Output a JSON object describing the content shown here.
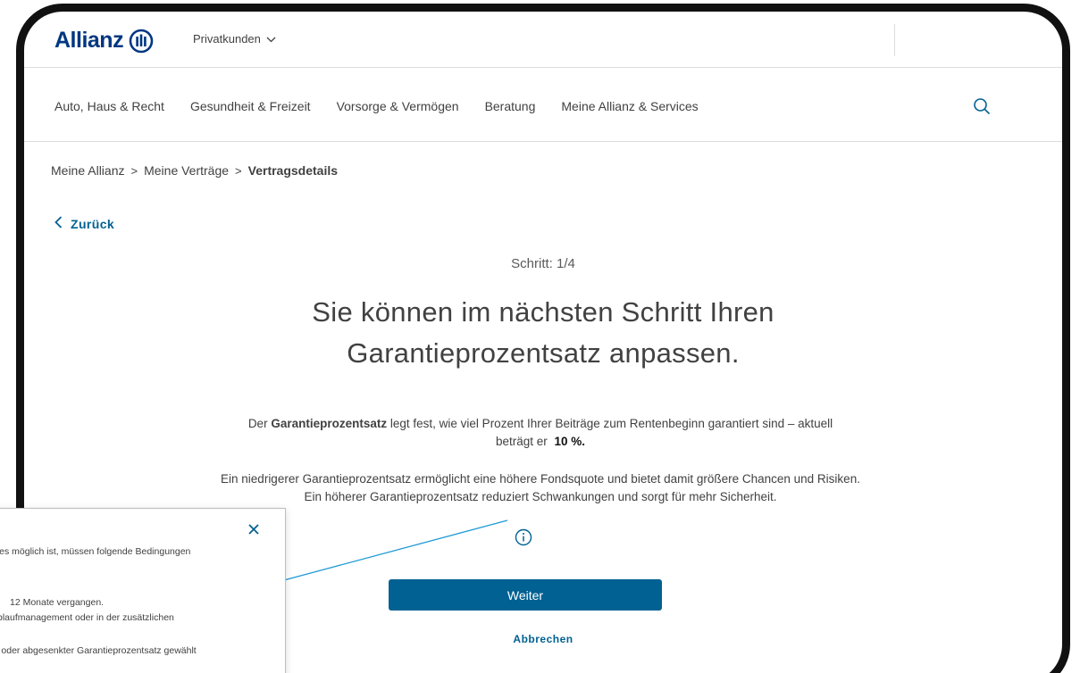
{
  "brand": {
    "name": "Allianz"
  },
  "topbar": {
    "segment_label": "Privatkunden"
  },
  "nav": {
    "items": [
      {
        "label": "Auto, Haus & Recht"
      },
      {
        "label": "Gesundheit & Freizeit"
      },
      {
        "label": "Vorsorge & Vermögen"
      },
      {
        "label": "Beratung"
      },
      {
        "label": "Meine Allianz & Services"
      }
    ]
  },
  "breadcrumb": {
    "items": [
      {
        "label": "Meine Allianz"
      },
      {
        "label": "Meine Verträge"
      },
      {
        "label": "Vertragsdetails"
      }
    ],
    "separator": ">"
  },
  "back": {
    "label": "Zurück"
  },
  "main": {
    "step": "Schritt: 1/4",
    "headline_line1": "Sie können im nächsten Schritt Ihren",
    "headline_line2": "Garantieprozentsatz anpassen.",
    "para1_prefix": "Der",
    "para1_bold": "Garantieprozentsatz",
    "para1_rest": "legt fest, wie viel Prozent Ihrer Beiträge zum Rentenbeginn garantiert sind – aktuell beträgt er",
    "para1_value": "10 %.",
    "para2": "Ein niedrigerer Garantieprozentsatz ermöglicht eine höhere Fondsquote und bietet damit größere Chancen und Risiken. Ein höherer Garantieprozentsatz reduziert Schwankungen und sorgt für mehr Sicherheit.",
    "primary_button": "Weiter",
    "secondary_link": "Abbrechen"
  },
  "popup": {
    "line1": "tzes möglich ist, müssen folgende Bedingungen",
    "line2": "12 Monate vergangen.",
    "line3": "blaufmanagement oder in der zusätzlichen",
    "line4": "r oder abgesenkter Garantieprozentsatz gewählt"
  },
  "colors": {
    "brand_blue": "#003781",
    "action_blue": "#006192",
    "text": "#414141",
    "callout_line": "#1e9ad6"
  }
}
